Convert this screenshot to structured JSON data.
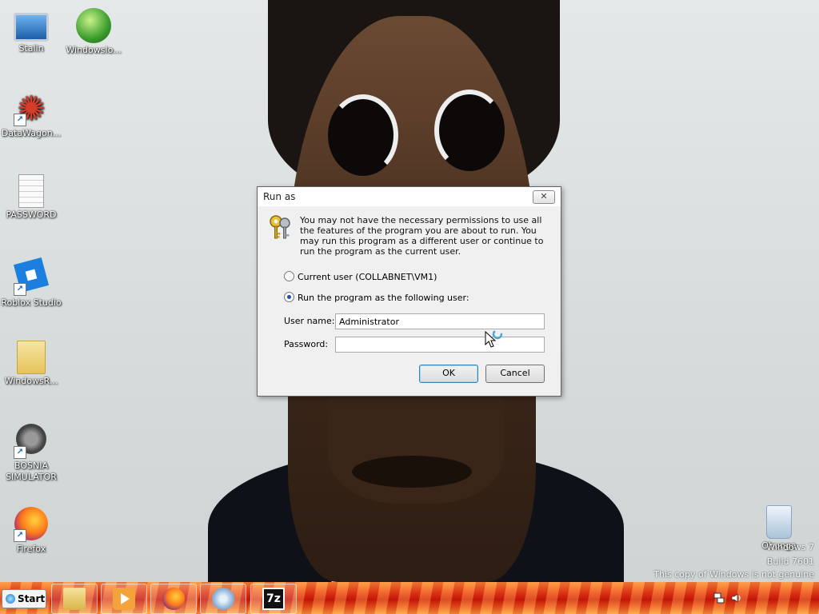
{
  "desktop": {
    "icons": [
      {
        "label": "Stalin",
        "icon": "computer-icon"
      },
      {
        "label": "WindowsIo...",
        "icon": "windows-globe-icon"
      },
      {
        "label": "DataWagon...",
        "icon": "star-app-icon"
      },
      {
        "label": "PASSWORD",
        "icon": "text-document-icon"
      },
      {
        "label": "Roblox Studio",
        "icon": "roblox-studio-icon"
      },
      {
        "label": "WindowsR...",
        "icon": "folder-icon"
      },
      {
        "label": "BOSNIA SIMULATOR",
        "icon": "mine-icon"
      },
      {
        "label": "Firefox",
        "icon": "firefox-icon"
      },
      {
        "label": "Obunga",
        "icon": "recycle-bin-icon"
      }
    ]
  },
  "dialog": {
    "title": "Run as",
    "close_symbol": "✕",
    "message": "You may not have the necessary permissions to use all the features of the program you are about to run. You may run this program as a different user or continue to run the program as the current user.",
    "option_current": "Current user (COLLABNET\\VM1)",
    "option_other": "Run the program as the following user:",
    "selected_option": "other",
    "username_label": "User name:",
    "username_value": "Administrator",
    "password_label": "Password:",
    "password_value": "",
    "ok_label": "OK",
    "cancel_label": "Cancel"
  },
  "watermark": {
    "line1": "Windows 7",
    "line2": "Build 7601",
    "line3": "This copy of Windows is not genuine"
  },
  "taskbar": {
    "start_label": "Start",
    "pinned": [
      "file-explorer-icon",
      "media-player-icon",
      "firefox-icon",
      "control-panel-icon",
      "7zip-icon"
    ],
    "tray": [
      "network-icon",
      "volume-icon"
    ]
  }
}
